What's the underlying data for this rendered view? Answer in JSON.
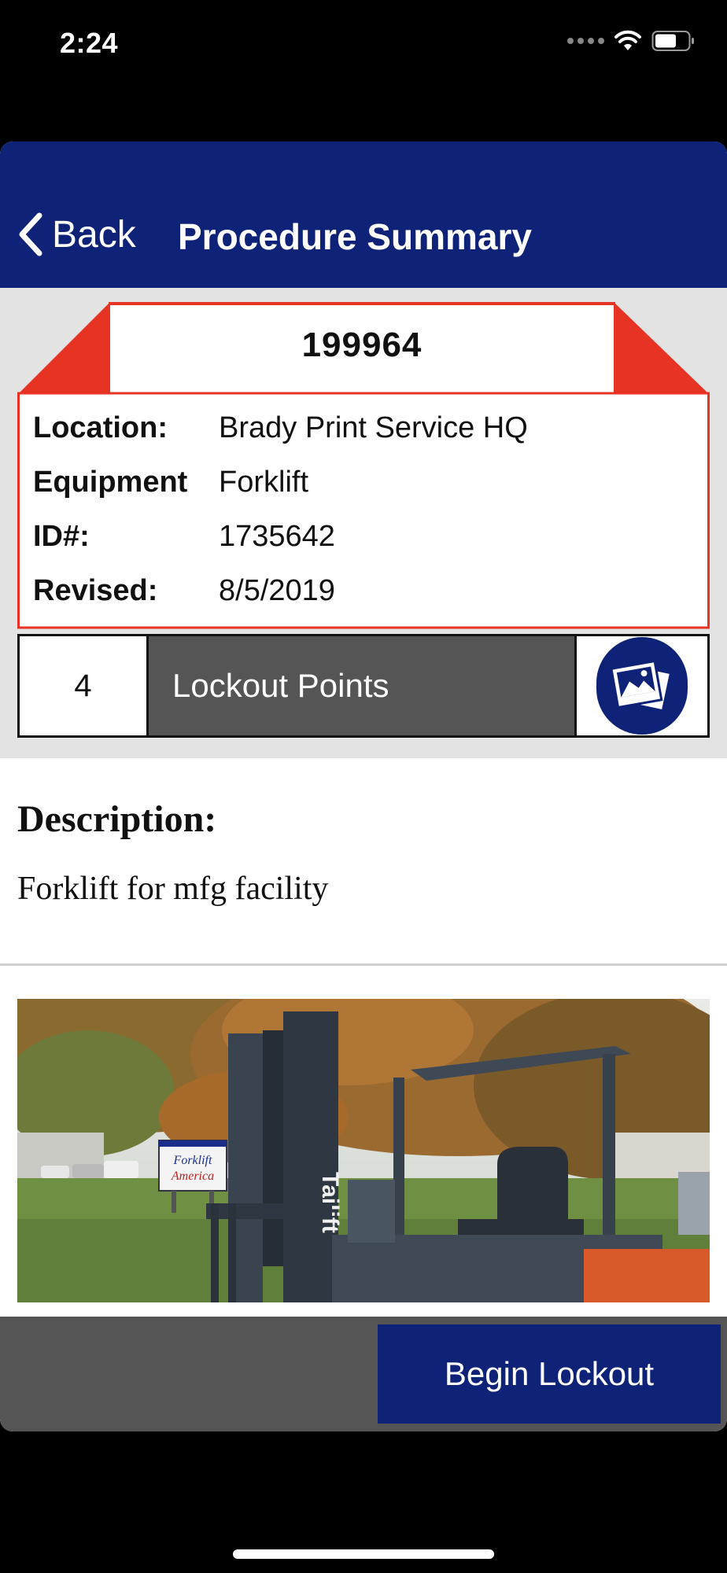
{
  "status_bar": {
    "time": "2:24"
  },
  "nav": {
    "back_label": "Back",
    "title": "Procedure Summary"
  },
  "tag": {
    "number": "199964",
    "rows": [
      {
        "key": "Location:",
        "value": "Brady Print Service HQ"
      },
      {
        "key": "Equipment",
        "value": "Forklift"
      },
      {
        "key": "ID#:",
        "value": "1735642"
      },
      {
        "key": "Revised:",
        "value": "8/5/2019"
      }
    ]
  },
  "lockout": {
    "count": "4",
    "label": "Lockout Points"
  },
  "description": {
    "heading": "Description:",
    "text": "Forklift for mfg facility"
  },
  "photo": {
    "sign_line1": "Forklift",
    "sign_line2": "America",
    "mast_brand": "Tailift"
  },
  "footer": {
    "begin_label": "Begin Lockout"
  },
  "colors": {
    "brand": "#0e2378",
    "tag_red": "#e63323",
    "strip_gray": "#555555"
  }
}
